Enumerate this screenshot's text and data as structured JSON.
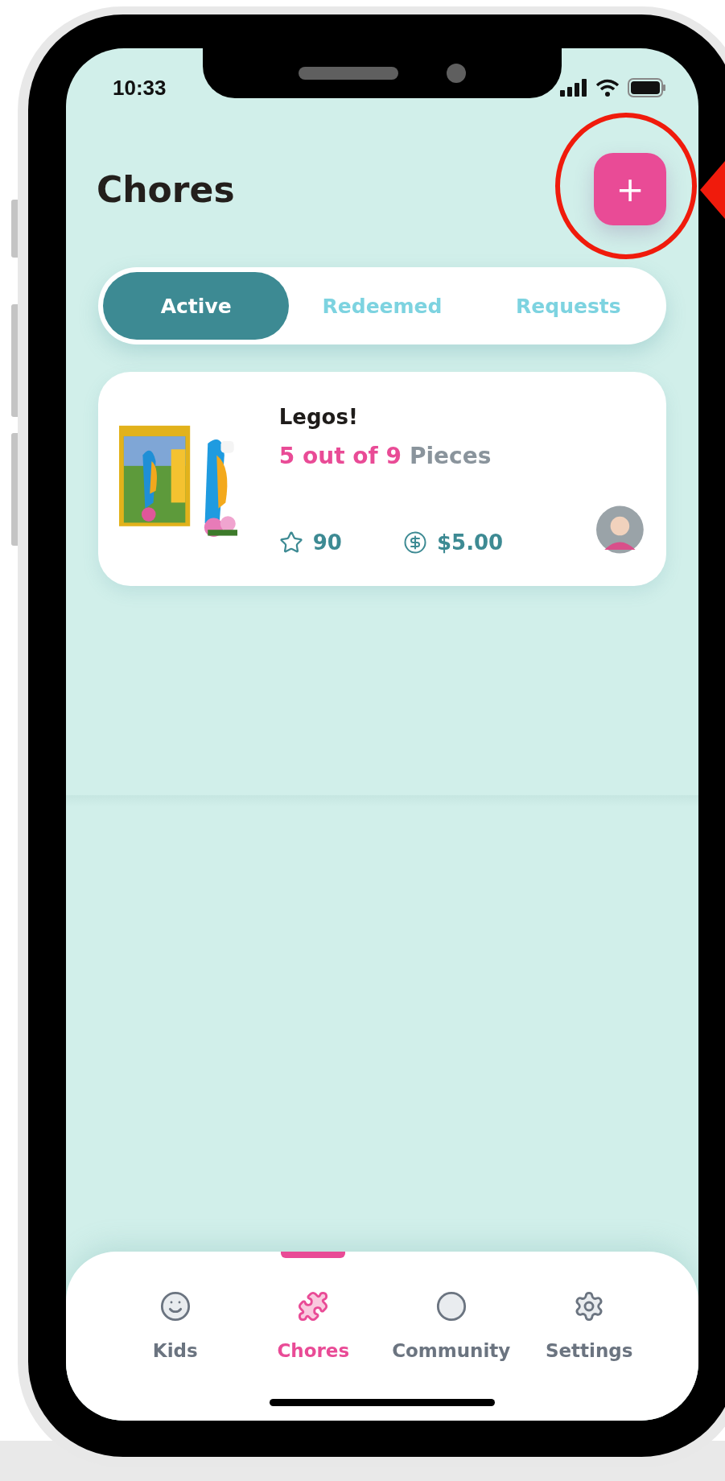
{
  "status_bar": {
    "time": "10:33"
  },
  "header": {
    "title": "Chores",
    "add_button": "+"
  },
  "tabs": [
    {
      "label": "Active",
      "selected": true
    },
    {
      "label": "Redeemed",
      "selected": false
    },
    {
      "label": "Requests",
      "selected": false
    }
  ],
  "chores": [
    {
      "title": "Legos!",
      "progress": "5 out of 9",
      "unit": "Pieces",
      "points": "90",
      "reward": "$5.00"
    }
  ],
  "nav": [
    {
      "label": "Kids",
      "selected": false
    },
    {
      "label": "Chores",
      "selected": true
    },
    {
      "label": "Community",
      "selected": false
    },
    {
      "label": "Settings",
      "selected": false
    }
  ]
}
